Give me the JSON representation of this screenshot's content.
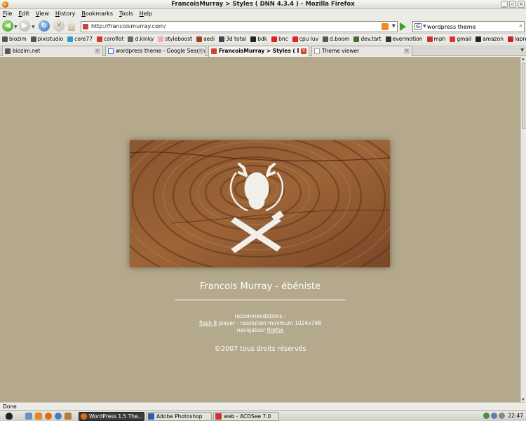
{
  "window": {
    "title": "FrancoisMurray > Styles ( DNN 4.3.4 ) - Mozilla Firefox",
    "buttons": [
      "_",
      "▫",
      "×"
    ]
  },
  "menu": [
    "File",
    "Edit",
    "View",
    "History",
    "Bookmarks",
    "Tools",
    "Help"
  ],
  "nav": {
    "url": "http://francoismurray.com/",
    "search_value": "wordpress theme",
    "search_engine": "G"
  },
  "bookmarks": [
    {
      "label": "biozim",
      "color": "#555555"
    },
    {
      "label": "pixistudio",
      "color": "#555555"
    },
    {
      "label": "core77",
      "color": "#2f9bd3"
    },
    {
      "label": "coroflot",
      "color": "#d9342b"
    },
    {
      "label": "d.kinky",
      "color": "#6a6a6a"
    },
    {
      "label": "styleboost",
      "color": "#f2a7c3"
    },
    {
      "label": "aedi",
      "color": "#a04020"
    },
    {
      "label": "3d total",
      "color": "#445"
    },
    {
      "label": "bdk",
      "color": "#222222"
    },
    {
      "label": "bnc",
      "color": "#d22"
    },
    {
      "label": "cpu luv",
      "color": "#d22"
    },
    {
      "label": "d.boom",
      "color": "#555555"
    },
    {
      "label": "dev.tart",
      "color": "#4a6a3a"
    },
    {
      "label": "evermotion",
      "color": "#333"
    },
    {
      "label": "mph",
      "color": "#c33"
    },
    {
      "label": "gmail",
      "color": "#d33"
    },
    {
      "label": "amazon",
      "color": "#222"
    },
    {
      "label": "lapresse",
      "color": "#c22"
    }
  ],
  "tabs": [
    {
      "label": "biozim.net",
      "active": false,
      "color": "#555555"
    },
    {
      "label": "wordpress theme - Google Search",
      "active": false,
      "color": "#3366cc"
    },
    {
      "label": "FrancoisMurray > Styles ( D...",
      "active": true,
      "color": "#c43"
    },
    {
      "label": "Theme viewer",
      "active": false,
      "color": "#ffffff"
    }
  ],
  "page": {
    "title": "Francois Murray - ébéniste",
    "rec_heading": "recommendations :",
    "rec_line2_link1": "flash 8",
    "rec_line2_rest": " player - resolution minimum 1024x768",
    "rec_line3_text": "navigateur ",
    "rec_line3_link": "firefox",
    "copyright": "©2007 tous droits réservés",
    "background": "#b4a98d"
  },
  "status": "Done",
  "taskbar": {
    "tasks": [
      {
        "label": "WordPress 1.5 The...",
        "active": true,
        "color": "#e36a12"
      },
      {
        "label": "Adobe Photoshop",
        "active": false,
        "color": "#2a5ea8"
      },
      {
        "label": "web - ACDSee 7.0",
        "active": false,
        "color": "#c33"
      }
    ],
    "clock": "22:47"
  }
}
